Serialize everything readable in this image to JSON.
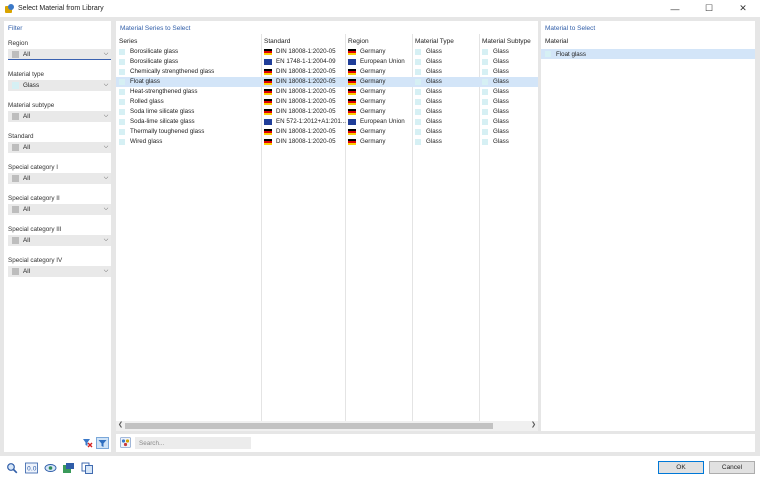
{
  "window": {
    "title": "Select Material from Library",
    "minimize_glyph": "—",
    "maximize_glyph": "☐",
    "close_glyph": "✕"
  },
  "filter": {
    "heading": "Filter",
    "fields": [
      {
        "label": "Region",
        "value": "All"
      },
      {
        "label": "Material type",
        "value": "Glass"
      },
      {
        "label": "Material subtype",
        "value": "All"
      },
      {
        "label": "Standard",
        "value": "All"
      },
      {
        "label": "Special category I",
        "value": "All"
      },
      {
        "label": "Special category II",
        "value": "All"
      },
      {
        "label": "Special category III",
        "value": "All"
      },
      {
        "label": "Special category IV",
        "value": "All"
      }
    ]
  },
  "series_panel": {
    "heading": "Material Series to Select",
    "columns": [
      "Series",
      "Standard",
      "Region",
      "Material Type",
      "Material Subtype"
    ],
    "rows": [
      {
        "series": "Borosilicate glass",
        "standard": "DIN 18008-1:2020-05",
        "flag": "de",
        "region": "Germany",
        "type": "Glass",
        "subtype": "Glass"
      },
      {
        "series": "Borosilicate glass",
        "standard": "EN 1748-1-1:2004-09",
        "flag": "eu",
        "region": "European Union",
        "type": "Glass",
        "subtype": "Glass"
      },
      {
        "series": "Chemically strengthened glass",
        "standard": "DIN 18008-1:2020-05",
        "flag": "de",
        "region": "Germany",
        "type": "Glass",
        "subtype": "Glass"
      },
      {
        "series": "Float glass",
        "standard": "DIN 18008-1:2020-05",
        "flag": "de",
        "region": "Germany",
        "type": "Glass",
        "subtype": "Glass"
      },
      {
        "series": "Heat-strengthened glass",
        "standard": "DIN 18008-1:2020-05",
        "flag": "de",
        "region": "Germany",
        "type": "Glass",
        "subtype": "Glass"
      },
      {
        "series": "Rolled glass",
        "standard": "DIN 18008-1:2020-05",
        "flag": "de",
        "region": "Germany",
        "type": "Glass",
        "subtype": "Glass"
      },
      {
        "series": "Soda lime silicate glass",
        "standard": "DIN 18008-1:2020-05",
        "flag": "de",
        "region": "Germany",
        "type": "Glass",
        "subtype": "Glass"
      },
      {
        "series": "Soda-lime silicate glass",
        "standard": "EN 572-1:2012+A1:201...",
        "flag": "eu",
        "region": "European Union",
        "type": "Glass",
        "subtype": "Glass"
      },
      {
        "series": "Thermally toughened glass",
        "standard": "DIN 18008-1:2020-05",
        "flag": "de",
        "region": "Germany",
        "type": "Glass",
        "subtype": "Glass"
      },
      {
        "series": "Wired glass",
        "standard": "DIN 18008-1:2020-05",
        "flag": "de",
        "region": "Germany",
        "type": "Glass",
        "subtype": "Glass"
      }
    ],
    "selected_row": "Float glass"
  },
  "search": {
    "placeholder": "Search..."
  },
  "target_panel": {
    "heading": "Material to Select",
    "column": "Material",
    "item": "Float glass"
  },
  "buttons": {
    "ok": "OK",
    "cancel": "Cancel"
  },
  "colors": {
    "accent": "#2f5da8",
    "selection": "#d3e5f8",
    "glass_swatch": "#d6f0f4",
    "all_swatch": "#bdbdbd"
  },
  "icons": {
    "toolbar": [
      "search-icon",
      "units-icon",
      "view-icon",
      "material-icon",
      "copy-icon"
    ],
    "filter": [
      "clear-filter-icon",
      "funnel-icon"
    ]
  }
}
